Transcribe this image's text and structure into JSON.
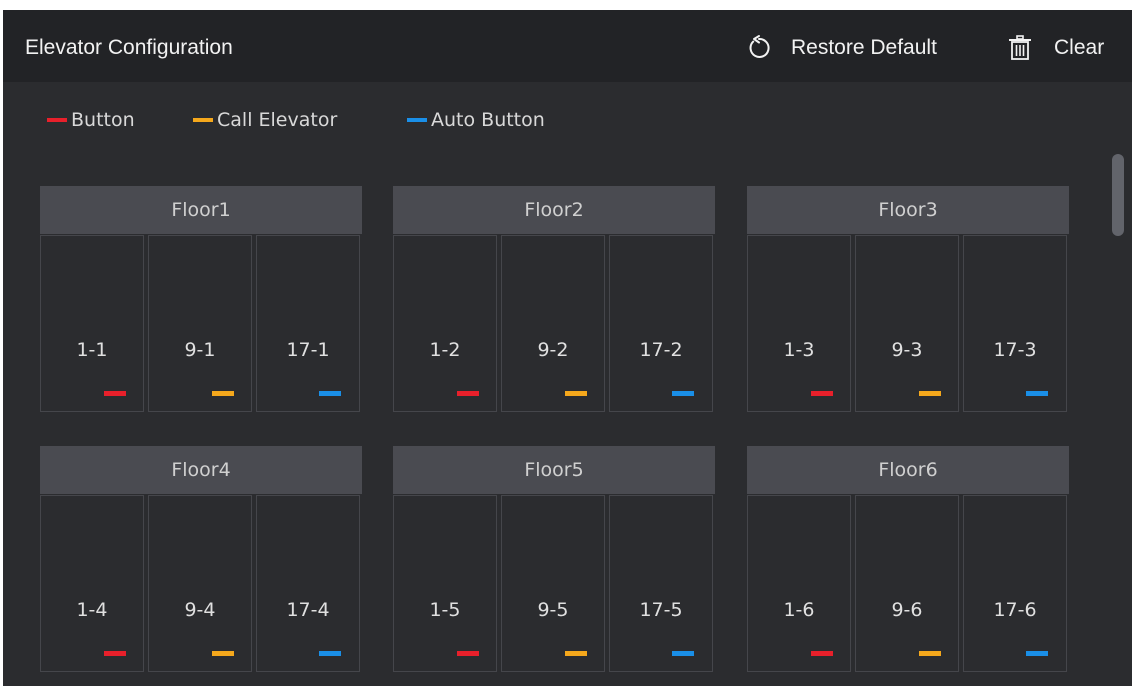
{
  "header": {
    "title": "Elevator Configuration",
    "restore_label": "Restore Default",
    "clear_label": "Clear"
  },
  "legend": [
    {
      "label": "Button",
      "color": "#e8202b"
    },
    {
      "label": "Call Elevator",
      "color": "#f5a81c"
    },
    {
      "label": "Auto Button",
      "color": "#1a8fe8"
    }
  ],
  "floors": [
    {
      "name": "Floor1",
      "cells": [
        {
          "label": "1-1",
          "type": "button"
        },
        {
          "label": "9-1",
          "type": "call"
        },
        {
          "label": "17-1",
          "type": "auto"
        }
      ]
    },
    {
      "name": "Floor2",
      "cells": [
        {
          "label": "1-2",
          "type": "button"
        },
        {
          "label": "9-2",
          "type": "call"
        },
        {
          "label": "17-2",
          "type": "auto"
        }
      ]
    },
    {
      "name": "Floor3",
      "cells": [
        {
          "label": "1-3",
          "type": "button"
        },
        {
          "label": "9-3",
          "type": "call"
        },
        {
          "label": "17-3",
          "type": "auto"
        }
      ]
    },
    {
      "name": "Floor4",
      "cells": [
        {
          "label": "1-4",
          "type": "button"
        },
        {
          "label": "9-4",
          "type": "call"
        },
        {
          "label": "17-4",
          "type": "auto"
        }
      ]
    },
    {
      "name": "Floor5",
      "cells": [
        {
          "label": "1-5",
          "type": "button"
        },
        {
          "label": "9-5",
          "type": "call"
        },
        {
          "label": "17-5",
          "type": "auto"
        }
      ]
    },
    {
      "name": "Floor6",
      "cells": [
        {
          "label": "1-6",
          "type": "button"
        },
        {
          "label": "9-6",
          "type": "call"
        },
        {
          "label": "17-6",
          "type": "auto"
        }
      ]
    }
  ],
  "colors": {
    "button": "#e8202b",
    "call": "#f5a81c",
    "auto": "#1a8fe8",
    "panel_bg": "#2b2c2f",
    "header_bg": "#222326",
    "floor_header_bg": "#4a4b51"
  },
  "icons": {
    "restore": "restore-icon",
    "clear": "trash-icon"
  }
}
